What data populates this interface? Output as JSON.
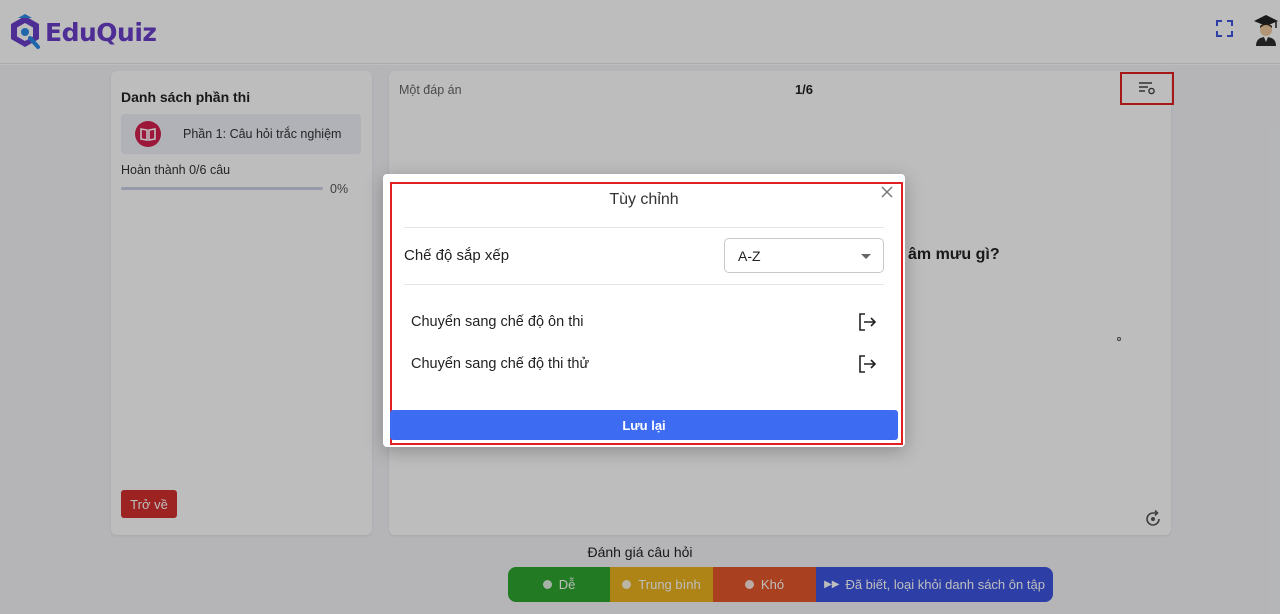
{
  "header": {
    "logo_text": "EduQuiz",
    "brand_color": "#6a3fc9",
    "fullscreen_icon": "fullscreen-icon",
    "avatar_icon": "graduate-avatar-icon"
  },
  "sidebar": {
    "title": "Danh sách phần thi",
    "sections": [
      {
        "label": "Phần 1: Câu hỏi trắc nghiệm",
        "icon": "book-icon",
        "icon_color": "#d3204e"
      }
    ],
    "progress_label": "Hoàn thành 0/6 câu",
    "progress_fraction": 0,
    "progress_percent_text": "0%",
    "back_label": "Trở về"
  },
  "question": {
    "answer_type": "Một đáp án",
    "counter": "1/6",
    "text_visible": "âm mưu gì?",
    "settings_icon": "list-settings-icon",
    "reset_icon": "reset-icon"
  },
  "rating": {
    "title": "Đánh giá câu hỏi",
    "buttons": [
      {
        "label": "Dễ",
        "color": "#2ea52e"
      },
      {
        "label": "Trung bình",
        "color": "#eab21d"
      },
      {
        "label": "Khó",
        "color": "#e4572a"
      },
      {
        "label": "Đã biết, loại khỏi danh sách ôn tập",
        "color": "#3d55e0"
      }
    ]
  },
  "modal": {
    "title": "Tùy chỉnh",
    "sort_label": "Chế độ sắp xếp",
    "sort_value": "A-Z",
    "modes": [
      {
        "label": "Chuyển sang chế độ ôn thi",
        "icon": "exit-arrow-icon"
      },
      {
        "label": "Chuyển sang chế độ thi thử",
        "icon": "exit-arrow-icon"
      }
    ],
    "save_label": "Lưu lại",
    "accent": "#3d6bf2",
    "highlight": "#e02020"
  }
}
